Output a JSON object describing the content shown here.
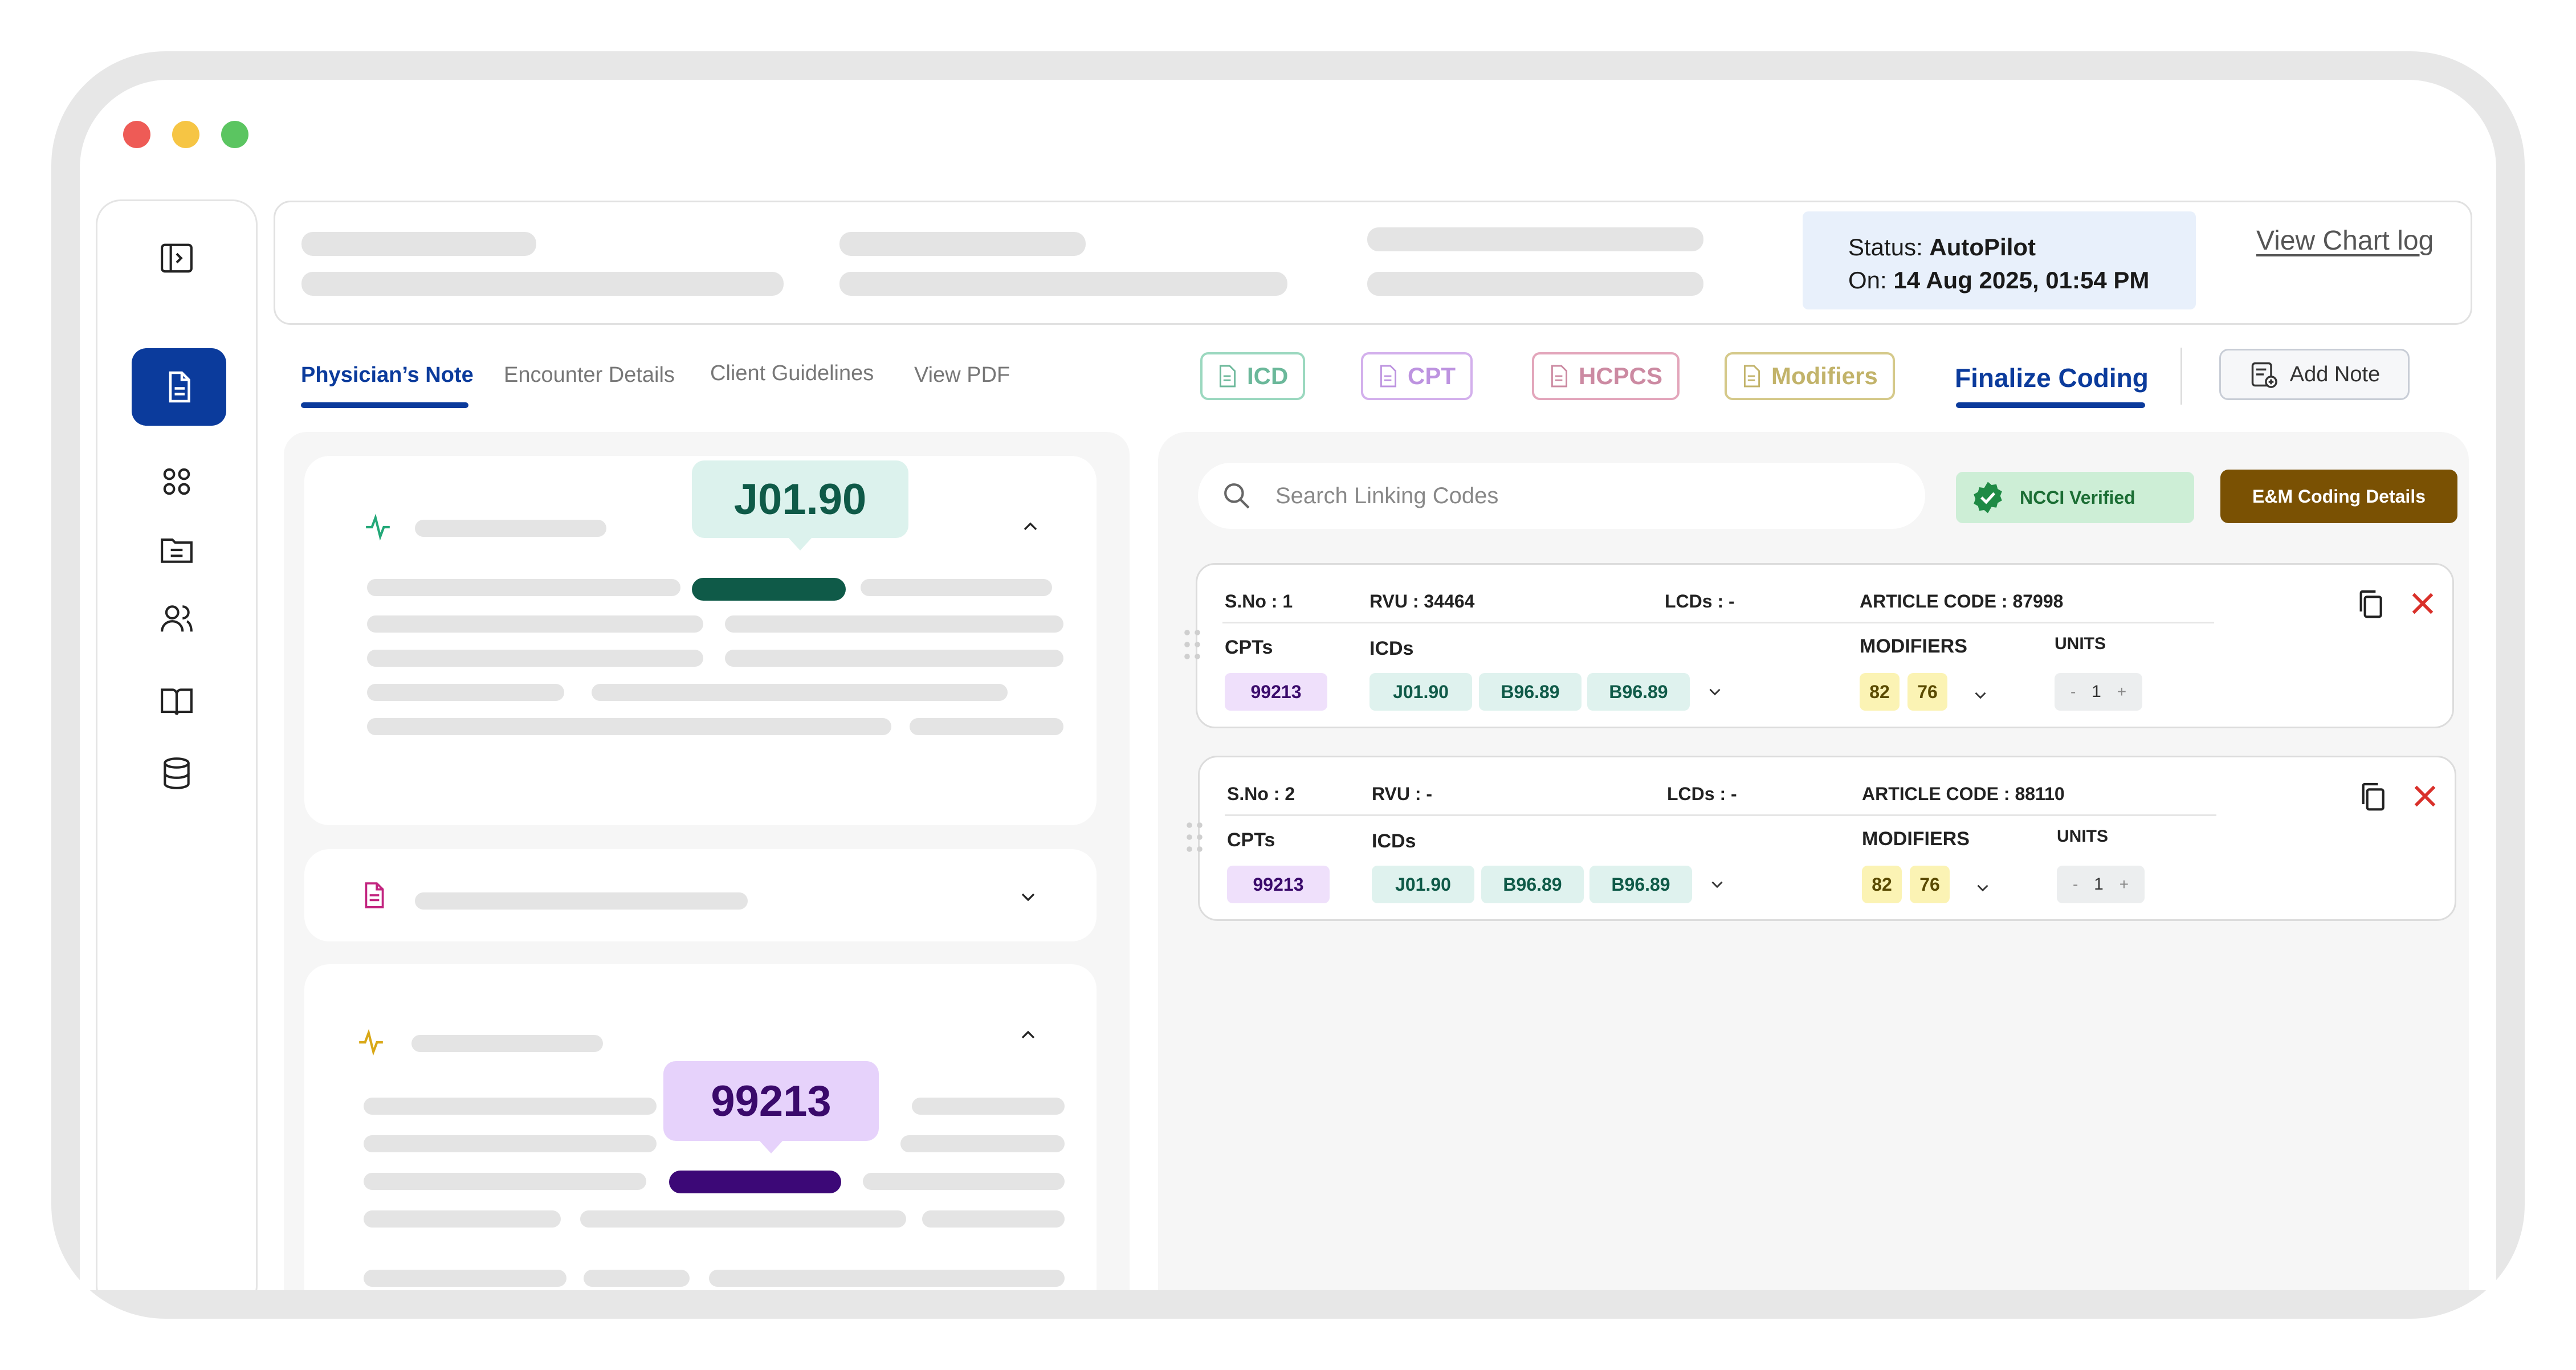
{
  "window": {
    "controls": [
      "close",
      "minimize",
      "maximize"
    ]
  },
  "header": {
    "status_label": "Status:",
    "status_value": "AutoPilot",
    "on_label": "On:",
    "on_value": "14 Aug 2025, 01:54 PM",
    "chart_log": "View Chart log"
  },
  "tabs": [
    {
      "label": "Physician’s Note",
      "active": true
    },
    {
      "label": "Encounter Details"
    },
    {
      "label": "Client Guidelines"
    },
    {
      "label": "View PDF"
    }
  ],
  "code_tabs": [
    {
      "label": "ICD",
      "color": "#76c7a8"
    },
    {
      "label": "CPT",
      "color": "#c79be6"
    },
    {
      "label": "HCPCS",
      "color": "#d98aa6"
    },
    {
      "label": "Modifiers",
      "color": "#c9b765"
    }
  ],
  "finalize_label": "Finalize Coding",
  "add_note_label": "Add Note",
  "note": {
    "highlight_1": "J01.90",
    "highlight_2": "99213"
  },
  "search": {
    "placeholder": "Search Linking Codes"
  },
  "ncci_label": "NCCI Verified",
  "em_label": "E&M Coding Details",
  "labels": {
    "cpts": "CPTs",
    "icds": "ICDs",
    "modifiers": "MODIFIERS",
    "units": "UNITS"
  },
  "rows": [
    {
      "sno": "S.No : 1",
      "rvu": "RVU : 34464",
      "lcds": "LCDs : -",
      "article": "ARTICLE CODE : 87998",
      "cpt": "99213",
      "icds": [
        "J01.90",
        "B96.89",
        "B96.89"
      ],
      "modifiers": [
        "82",
        "76"
      ],
      "units": {
        "minus": "-",
        "value": "1",
        "plus": "+"
      }
    },
    {
      "sno": "S.No : 2",
      "rvu": "RVU : -",
      "lcds": "LCDs : -",
      "article": "ARTICLE CODE : 88110",
      "cpt": "99213",
      "icds": [
        "J01.90",
        "B96.89",
        "B96.89"
      ],
      "modifiers": [
        "82",
        "76"
      ],
      "units": {
        "minus": "-",
        "value": "1",
        "plus": "+"
      }
    }
  ],
  "colors": {
    "primary": "#0b3b9c",
    "icd": "#0f5a48",
    "cpt": "#3a0a6b",
    "delete": "#d9302a",
    "brown": "#7a5103"
  }
}
